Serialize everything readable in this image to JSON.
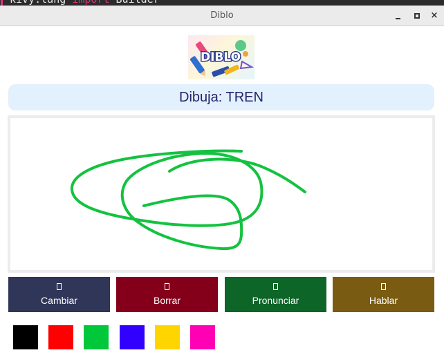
{
  "editor": {
    "line_prefix": "kivy.lang ",
    "line_keyword": "import",
    "line_suffix": " Builder"
  },
  "window": {
    "title": "Diblo",
    "close_glyph": "×"
  },
  "logo": {
    "text": "DIBLO"
  },
  "prompt": {
    "text": "Dibuja: TREN"
  },
  "drawing": {
    "stroke_color": "#14c240"
  },
  "actions": [
    {
      "label": "Cambiar",
      "icon": "swap-icon",
      "color": "#303658"
    },
    {
      "label": "Borrar",
      "icon": "eraser-icon",
      "color": "#84001a"
    },
    {
      "label": "Pronunciar",
      "icon": "speaker-icon",
      "color": "#0d6527"
    },
    {
      "label": "Hablar",
      "icon": "microphone-icon",
      "color": "#795c12"
    }
  ],
  "palette": [
    {
      "name": "black",
      "color": "#000000"
    },
    {
      "name": "red",
      "color": "#ff0000"
    },
    {
      "name": "green",
      "color": "#00c83a"
    },
    {
      "name": "blue",
      "color": "#3200ff"
    },
    {
      "name": "yellow",
      "color": "#ffd500"
    },
    {
      "name": "pink",
      "color": "#ff00b4"
    }
  ]
}
